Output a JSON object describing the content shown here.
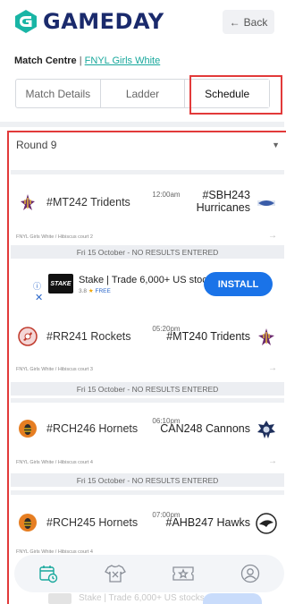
{
  "header": {
    "brand": "GAMEDAY",
    "back_label": "Back",
    "brand_color": "#1a2a6c"
  },
  "breadcrumb": {
    "label": "Match Centre",
    "separator": "|",
    "link": "FNYL Girls White"
  },
  "tabs": [
    {
      "label": "Match Details",
      "active": false
    },
    {
      "label": "Ladder",
      "active": false
    },
    {
      "label": "Schedule",
      "active": true
    }
  ],
  "round_select": {
    "value": "Round 9"
  },
  "matches": [
    {
      "home": "#MT242 Tridents",
      "time": "12:00am",
      "away": "#SBH243 Hurricanes",
      "meta": "FNYL Girls White / Hibiscus court 2",
      "status": "Fri 15 October - NO RESULTS ENTERED"
    },
    {
      "home": "#RR241 Rockets",
      "time": "05:20pm",
      "away": "#MT240 Tridents",
      "meta": "FNYL Girls White / Hibiscus court 3",
      "status": "Fri 15 October - NO RESULTS ENTERED"
    },
    {
      "home": "#RCH246 Hornets",
      "time": "06:10pm",
      "away": "CAN248 Cannons",
      "meta": "FNYL Girls White / Hibiscus court 4",
      "status": "Fri 15 October - NO RESULTS ENTERED"
    },
    {
      "home": "#RCH245 Hornets",
      "time": "07:00pm",
      "away": "#AHB247 Hawks",
      "meta": "FNYL Girls White / Hibiscus court 4",
      "status": ""
    }
  ],
  "ad": {
    "logo_text": "STAKE",
    "title": "Stake | Trade 6,000+ US stocks",
    "rating": "3.8",
    "star": "★",
    "price": "FREE",
    "cta": "INSTALL",
    "ghost_text": "Stake | Trade 6,000+ US stocks"
  },
  "bottom_nav": [
    {
      "icon": "calendar-clock-icon",
      "active": true
    },
    {
      "icon": "jersey-icon",
      "active": false
    },
    {
      "icon": "ticket-star-icon",
      "active": false
    },
    {
      "icon": "user-icon",
      "active": false
    }
  ],
  "colors": {
    "accent": "#18a89c",
    "highlight": "#e23a3a",
    "install": "#1a73e8"
  }
}
